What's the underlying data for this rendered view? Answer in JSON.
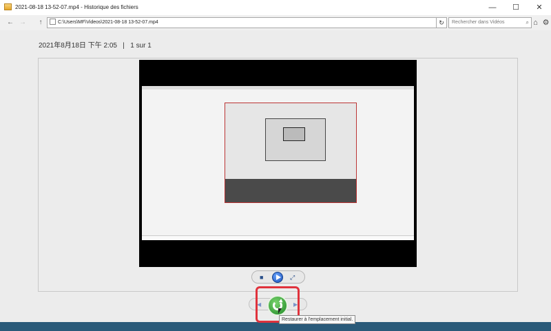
{
  "window": {
    "title": "2021-08-18 13-52-07.mp4 - Historique des fichiers",
    "minimize_glyph": "—",
    "maximize_glyph": "☐",
    "close_glyph": "✕"
  },
  "nav": {
    "back_glyph": "←",
    "forward_glyph": "→",
    "up_glyph": "↑",
    "address": "C:\\Users\\MF\\Videos\\2021-08-18 13-52-07.mp4",
    "refresh_glyph": "↻",
    "search_placeholder": "Rechercher dans Vidéos",
    "search_glyph": "⌕",
    "home_glyph": "⌂",
    "settings_glyph": "⚙"
  },
  "header": {
    "date": "2021年8月18日 下午 2:05",
    "separator": "|",
    "position": "1 sur 1"
  },
  "playback": {
    "stop_glyph": "■",
    "fullscreen_glyph": "⤢"
  },
  "restore": {
    "prev_glyph": "◀",
    "next_glyph": "▶|",
    "tooltip": "Restaurer à l'emplacement initial."
  },
  "colors": {
    "highlight": "#e0323c",
    "restore_green": "#2e9a33",
    "play_blue": "#1a4fb8",
    "desktop": "#2a5a79"
  },
  "icons": [
    "app-icon",
    "back-icon",
    "forward-icon",
    "up-icon",
    "refresh-icon",
    "search-icon",
    "home-icon",
    "gear-icon",
    "stop-icon",
    "play-icon",
    "fullscreen-icon",
    "previous-icon",
    "restore-icon",
    "next-icon"
  ]
}
